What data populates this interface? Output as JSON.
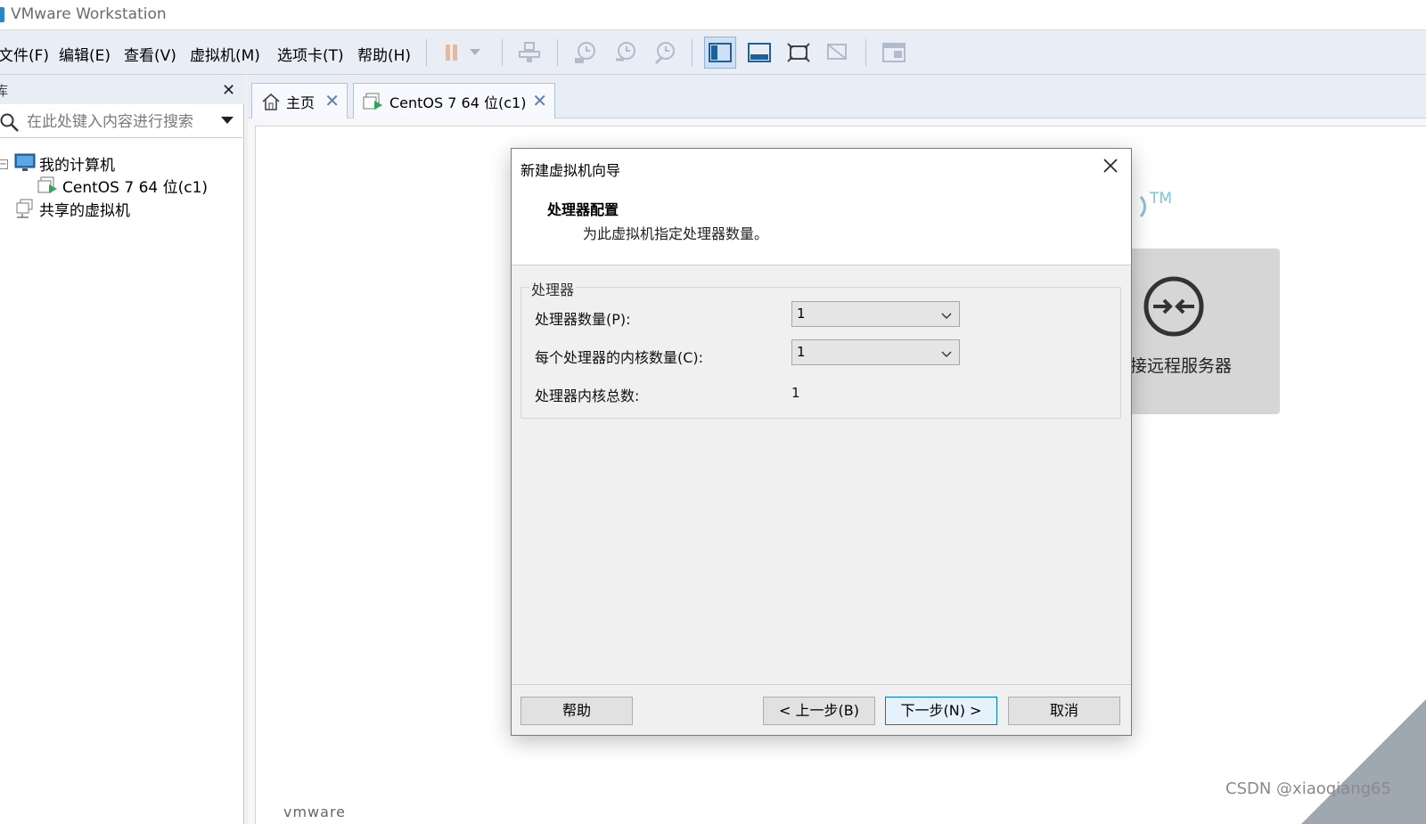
{
  "window": {
    "title": "VMware Workstation"
  },
  "menu": {
    "file": "文件(F)",
    "edit": "编辑(E)",
    "view": "查看(V)",
    "vm": "虚拟机(M)",
    "tabs": "选项卡(T)",
    "help": "帮助(H)"
  },
  "library": {
    "header": "库",
    "close": "✕",
    "search_placeholder": "在此处键入内容进行搜索",
    "tree": {
      "my_computer": "我的计算机",
      "vm_centos": "CentOS 7 64 位(c1)",
      "shared_vms": "共享的虚拟机"
    }
  },
  "tabs": [
    {
      "label": "主页"
    },
    {
      "label": "CentOS 7 64 位(c1)"
    }
  ],
  "home": {
    "tm": "TM",
    "remote_server_label": "接远程服务器",
    "brand_peek": "vmware"
  },
  "dialog": {
    "title": "新建虚拟机向导",
    "section_title": "处理器配置",
    "section_desc": "为此虚拟机指定处理器数量。",
    "group_label": "处理器",
    "fields": {
      "processor_count_label": "处理器数量(P):",
      "processor_count_value": "1",
      "cores_per_processor_label": "每个处理器的内核数量(C):",
      "cores_per_processor_value": "1",
      "total_cores_label": "处理器内核总数:",
      "total_cores_value": "1"
    },
    "buttons": {
      "help": "帮助",
      "back": "< 上一步(B)",
      "next": "下一步(N) >",
      "cancel": "取消"
    }
  },
  "watermark": "CSDN @xiaoqiang65",
  "colors": {
    "accent": "#0078d7",
    "toolbar_bg": "#e9eef6",
    "tab_close": "#5b80b4",
    "teal_logo": "#7fc4d8"
  }
}
